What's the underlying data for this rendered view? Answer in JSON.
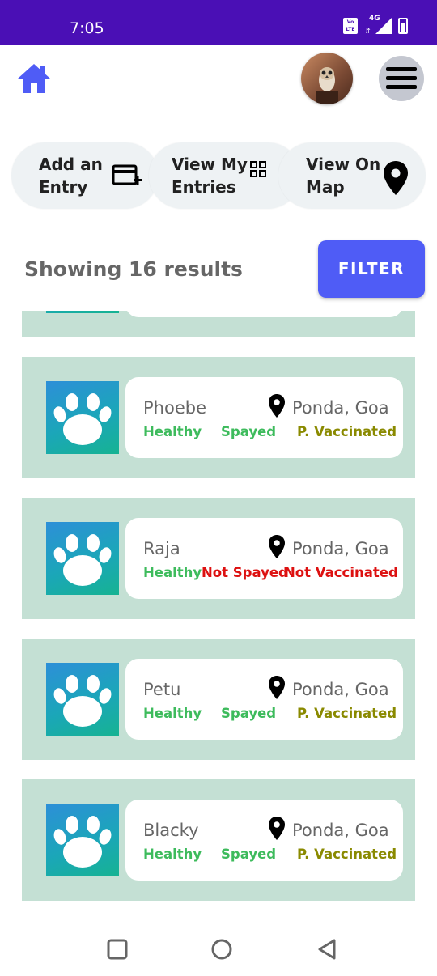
{
  "status_bar": {
    "time": "7:05",
    "network": "4G",
    "volte_label": "Vo LTE",
    "bg_color": "#4a0fb5"
  },
  "header": {
    "home_icon": "home-icon",
    "avatar": "owl-photo-avatar",
    "menu_icon": "hamburger-menu-icon"
  },
  "actions": [
    {
      "label": "Add an\nEntry",
      "icon": "add-card-icon"
    },
    {
      "label": "View My\nEntries",
      "icon": "grid-icon"
    },
    {
      "label": "View On\nMap",
      "icon": "map-pin-icon"
    }
  ],
  "results": {
    "text": "Showing 16 results",
    "filter_label": "FILTER",
    "accent_color": "#4f5cf6"
  },
  "colors": {
    "card_bg": "#c4e0d4",
    "healthy": "#3dbb5c",
    "spayed": "#3dbb5c",
    "partial": "#8a8a00",
    "negative": "#dd1111"
  },
  "entries": [
    {
      "name": "Phoebe",
      "location": "Ponda, Goa",
      "health": "Healthy",
      "spay": "Spayed",
      "vaccination": "P. Vaccinated",
      "spay_ok": true,
      "vacc_ok": true
    },
    {
      "name": "Raja",
      "location": "Ponda, Goa",
      "health": "Healthy",
      "spay": "Not Spayed",
      "vaccination": "Not Vaccinated",
      "spay_ok": false,
      "vacc_ok": false
    },
    {
      "name": "Petu",
      "location": "Ponda, Goa",
      "health": "Healthy",
      "spay": "Spayed",
      "vaccination": "P. Vaccinated",
      "spay_ok": true,
      "vacc_ok": true
    },
    {
      "name": "Blacky",
      "location": "Ponda, Goa",
      "health": "Healthy",
      "spay": "Spayed",
      "vaccination": "P. Vaccinated",
      "spay_ok": true,
      "vacc_ok": true
    }
  ],
  "nav": {
    "recent_icon": "square-recents-icon",
    "home_icon": "circle-home-icon",
    "back_icon": "triangle-back-icon"
  }
}
